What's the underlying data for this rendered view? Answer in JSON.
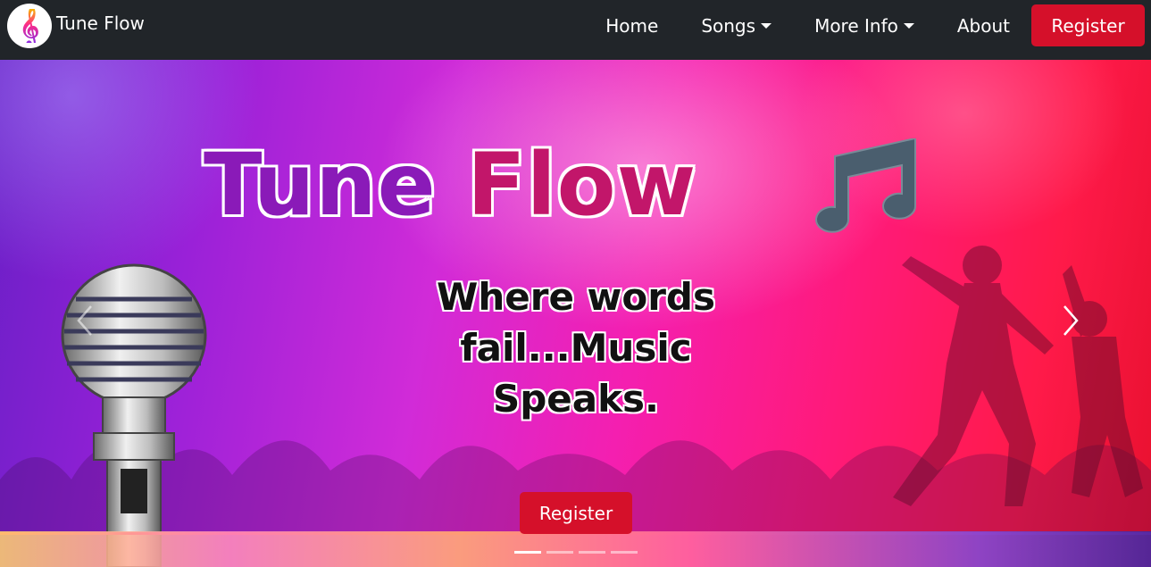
{
  "brand": {
    "name": "Tune Flow",
    "logo_icon": "treble-clef-icon",
    "logo_glyph": "𝄞"
  },
  "nav": {
    "home": "Home",
    "songs": "Songs",
    "more_info": "More Info",
    "about": "About",
    "register": "Register"
  },
  "hero": {
    "title_part1": "Tune ",
    "title_part2": "Flow",
    "tagline_line1": "Where words",
    "tagline_line2": "fail...Music",
    "tagline_line3": "Speaks.",
    "register_button": "Register",
    "slide_count": 4,
    "active_slide": 1
  },
  "colors": {
    "navbar_bg": "#212529",
    "accent_red": "#d5102a",
    "title_purple": "#8a1ab8",
    "title_pink": "#c2166a"
  }
}
